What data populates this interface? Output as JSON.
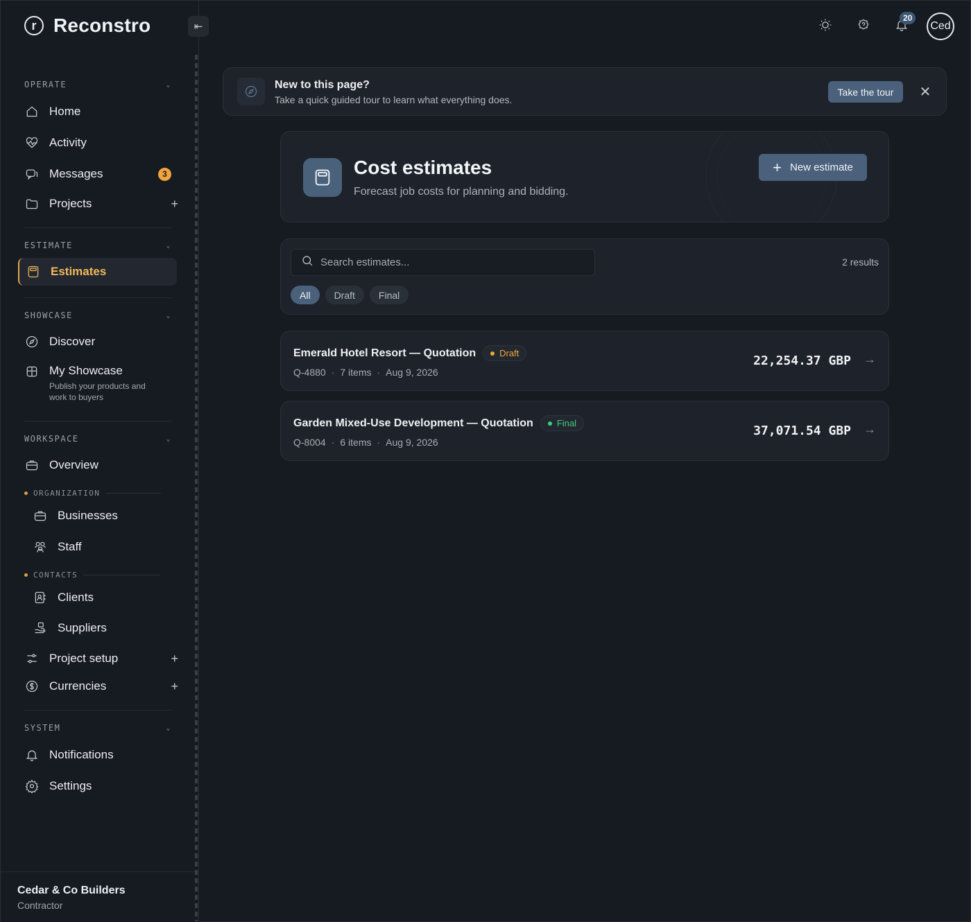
{
  "brand": {
    "logo_letter": "r",
    "name": "Reconstro"
  },
  "sidebar": {
    "sections": {
      "operate": "OPERATE",
      "estimate": "ESTIMATE",
      "showcase": "SHOWCASE",
      "workspace": "WORKSPACE",
      "system": "SYSTEM"
    },
    "items": {
      "home": "Home",
      "activity": "Activity",
      "messages": "Messages",
      "messages_badge": "3",
      "projects": "Projects",
      "estimates": "Estimates",
      "discover": "Discover",
      "my_showcase": "My Showcase",
      "my_showcase_sub": "Publish your products and work to buyers",
      "overview": "Overview",
      "businesses": "Businesses",
      "staff": "Staff",
      "clients": "Clients",
      "suppliers": "Suppliers",
      "project_setup": "Project setup",
      "currencies": "Currencies",
      "notifications": "Notifications",
      "settings": "Settings"
    },
    "groups": {
      "organization": "ORGANIZATION",
      "contacts": "CONTACTS"
    },
    "plus": "+",
    "footer": {
      "org_name": "Cedar & Co Builders",
      "org_role": "Contractor"
    }
  },
  "topbar": {
    "notification_count": "20",
    "avatar_text": "Ced"
  },
  "tour": {
    "title": "New to this page?",
    "subtitle": "Take a quick guided tour to learn what everything does.",
    "button": "Take the tour",
    "close": "✕"
  },
  "header": {
    "title": "Cost estimates",
    "subtitle": "Forecast job costs for planning and bidding.",
    "new_button": "New estimate"
  },
  "filters": {
    "search_placeholder": "Search estimates...",
    "result_count": "2 results",
    "chips": [
      "All",
      "Draft",
      "Final"
    ]
  },
  "estimates": [
    {
      "title": "Emerald Hotel Resort — Quotation",
      "status": "Draft",
      "status_color": "#f0a53a",
      "code": "Q-4880",
      "items": "7 items",
      "date": "Aug 9, 2026",
      "amount": "22,254.37 GBP"
    },
    {
      "title": "Garden Mixed-Use Development — Quotation",
      "status": "Final",
      "status_color": "#3ecf7a",
      "code": "Q-8004",
      "items": "6 items",
      "date": "Aug 9, 2026",
      "amount": "37,071.54 GBP"
    }
  ],
  "colors": {
    "accent": "#4a607b",
    "active_nav": "#f2b95a",
    "background": "#161b22"
  }
}
